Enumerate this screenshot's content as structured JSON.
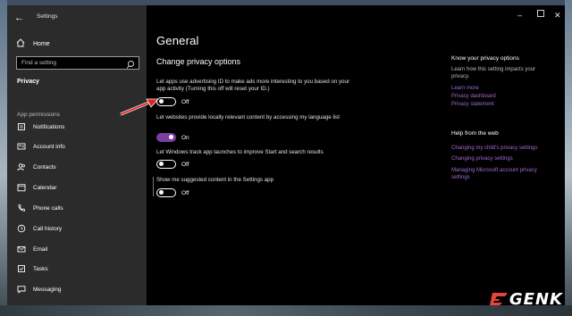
{
  "window": {
    "title": "Settings"
  },
  "sidebar": {
    "home_label": "Home",
    "search_placeholder": "Find a setting",
    "section_label": "Privacy",
    "group_label": "App permissions",
    "items": [
      {
        "label": "Notifications",
        "icon": "notifications-icon"
      },
      {
        "label": "Account info",
        "icon": "account-info-icon"
      },
      {
        "label": "Contacts",
        "icon": "contacts-icon"
      },
      {
        "label": "Calendar",
        "icon": "calendar-icon"
      },
      {
        "label": "Phone calls",
        "icon": "phone-icon"
      },
      {
        "label": "Call history",
        "icon": "call-history-icon"
      },
      {
        "label": "Email",
        "icon": "email-icon"
      },
      {
        "label": "Tasks",
        "icon": "tasks-icon"
      },
      {
        "label": "Messaging",
        "icon": "messaging-icon"
      }
    ]
  },
  "main": {
    "title": "General",
    "subtitle": "Change privacy options",
    "settings": [
      {
        "description": "Let apps use advertising ID to make ads more interesting to you based on your app activity (Turning this off will reset your ID.)",
        "on": false,
        "state_label": "Off"
      },
      {
        "description": "Let websites provide locally relevant content by accessing my language list",
        "on": true,
        "state_label": "On"
      },
      {
        "description": "Let Windows track app launches to improve Start and search results",
        "on": false,
        "state_label": "Off"
      },
      {
        "description": "Show me suggested content in the Settings app",
        "on": false,
        "state_label": "Off"
      }
    ]
  },
  "right_panel": {
    "know_heading": "Know your privacy options",
    "know_text": "Learn how this setting impacts your privacy.",
    "know_links": [
      "Learn more",
      "Privacy dashboard",
      "Privacy statement"
    ],
    "help_heading": "Help from the web",
    "help_links": [
      "Changing my child's privacy settings",
      "Changing privacy settings",
      "Managing Microsoft account privacy settings"
    ]
  },
  "watermark": {
    "text": "GENK"
  },
  "colors": {
    "accent": "#7a3ea0",
    "link": "#a06ad0",
    "annotation": "#e02020"
  }
}
